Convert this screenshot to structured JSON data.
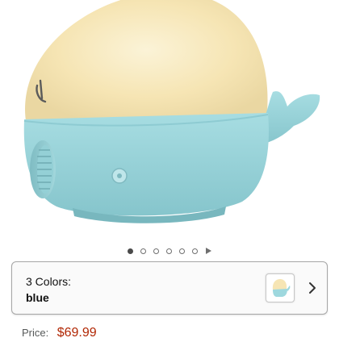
{
  "carousel": {
    "image_count": 6,
    "active_index": 0,
    "icons": [
      "dot-icon",
      "play-icon"
    ]
  },
  "variant": {
    "label": "3 Colors:",
    "value": "blue"
  },
  "price": {
    "label": "Price:",
    "value": "$69.99"
  },
  "colors": {
    "glow": "#f6e5b4",
    "body": "#9ed8de",
    "price": "#b12704"
  }
}
